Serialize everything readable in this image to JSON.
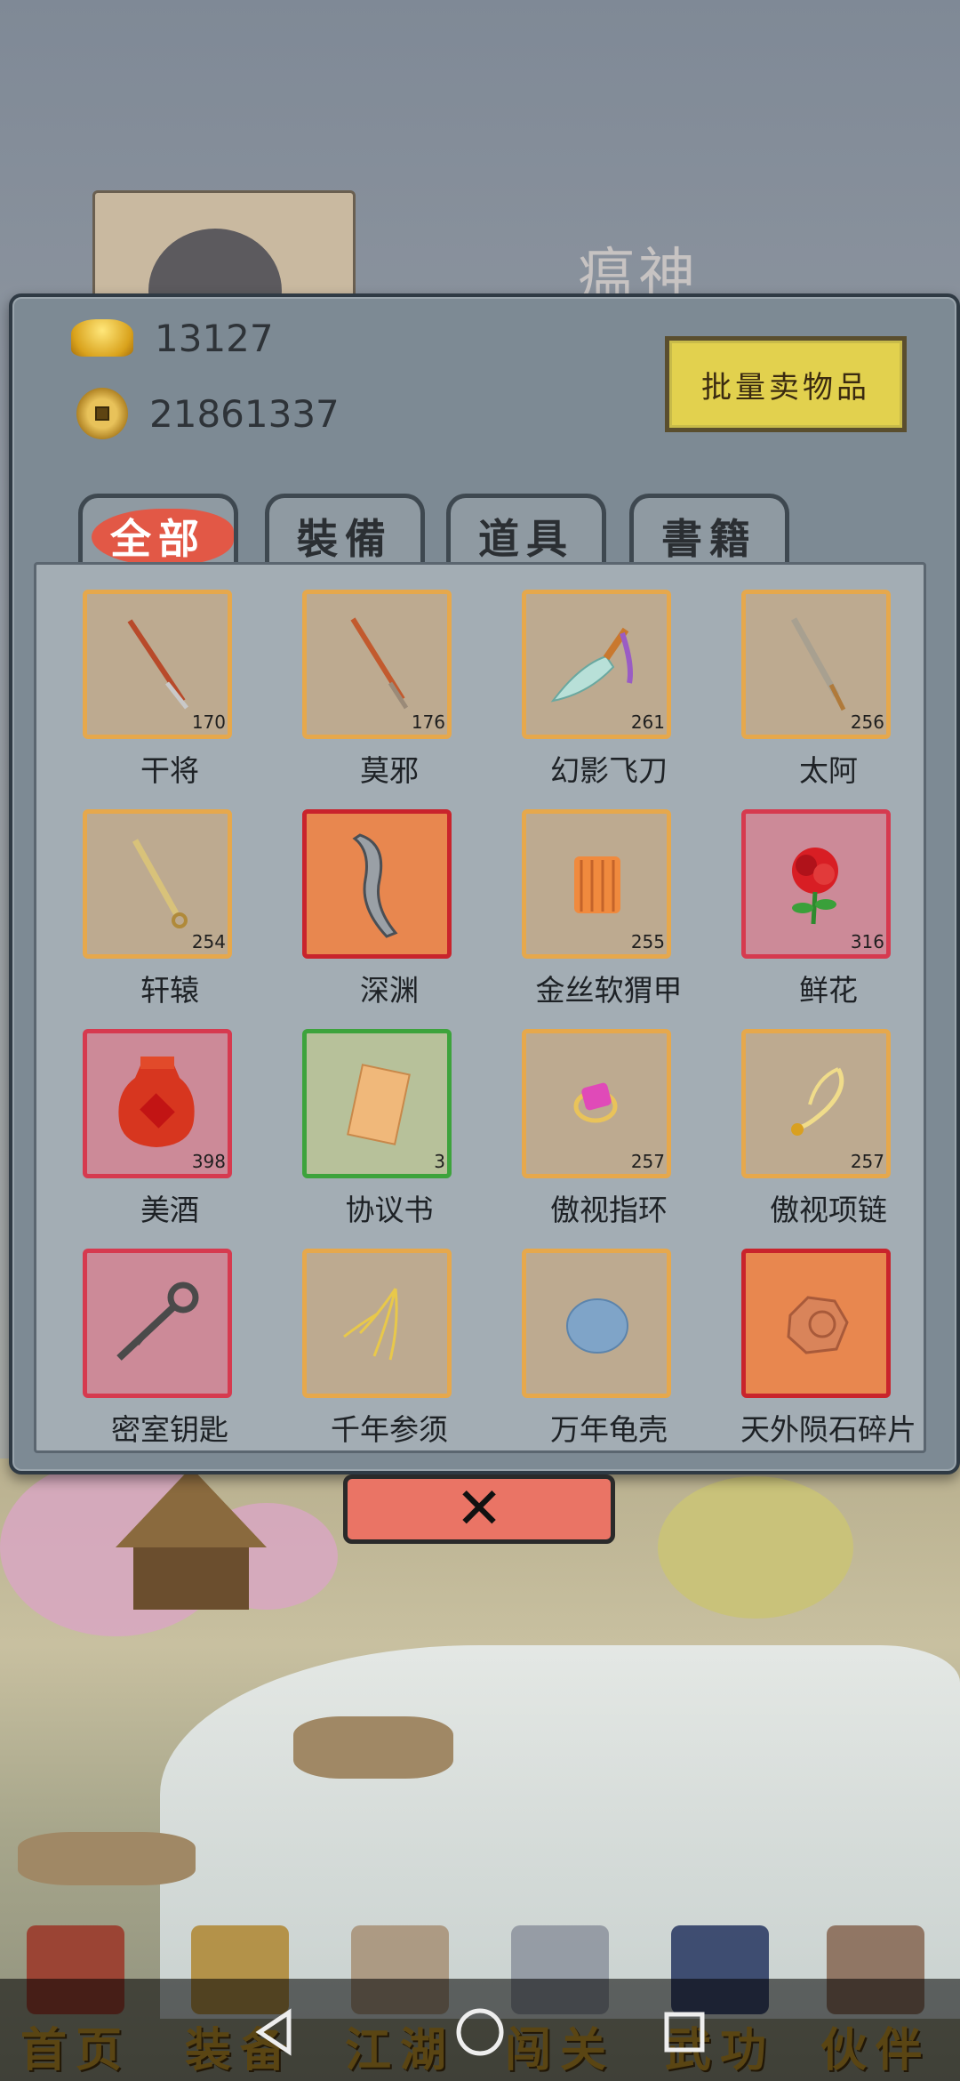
{
  "hero": {
    "name": "瘟神"
  },
  "currency": {
    "gold": "13127",
    "coins": "21861337"
  },
  "sell_button_label": "批量卖物品",
  "tabs": [
    {
      "label": "全部",
      "active": true
    },
    {
      "label": "裝備",
      "active": false
    },
    {
      "label": "道具",
      "active": false
    },
    {
      "label": "書籍",
      "active": false
    }
  ],
  "items": [
    {
      "name": "干将",
      "count": "170",
      "frame": "gold",
      "icon": "sword-icon"
    },
    {
      "name": "莫邪",
      "count": "176",
      "frame": "gold",
      "icon": "sword-icon"
    },
    {
      "name": "幻影飞刀",
      "count": "261",
      "frame": "gold",
      "icon": "flying-knife-icon"
    },
    {
      "name": "太阿",
      "count": "256",
      "frame": "gold",
      "icon": "sword-icon"
    },
    {
      "name": "轩辕",
      "count": "254",
      "frame": "gold",
      "icon": "sword-icon"
    },
    {
      "name": "深渊",
      "count": "",
      "frame": "orange-red",
      "icon": "blade-icon"
    },
    {
      "name": "金丝软猬甲",
      "count": "255",
      "frame": "gold",
      "icon": "armor-icon"
    },
    {
      "name": "鲜花",
      "count": "316",
      "frame": "red",
      "icon": "rose-icon"
    },
    {
      "name": "美酒",
      "count": "398",
      "frame": "red",
      "icon": "wine-jar-icon"
    },
    {
      "name": "协议书",
      "count": "3",
      "frame": "green",
      "icon": "scroll-icon"
    },
    {
      "name": "傲视指环",
      "count": "257",
      "frame": "gold",
      "icon": "ring-icon"
    },
    {
      "name": "傲视项链",
      "count": "257",
      "frame": "gold",
      "icon": "necklace-icon"
    },
    {
      "name": "密室钥匙",
      "count": "",
      "frame": "red",
      "icon": "key-icon"
    },
    {
      "name": "千年参须",
      "count": "",
      "frame": "gold",
      "icon": "ginseng-icon"
    },
    {
      "name": "万年龟壳",
      "count": "",
      "frame": "gold",
      "icon": "turtle-shell-icon"
    },
    {
      "name": "天外陨石碎片",
      "count": "",
      "frame": "orange-red",
      "icon": "meteorite-icon"
    }
  ],
  "close_label": "✕",
  "bottom_nav": [
    {
      "label": "首页",
      "icon": "temple-icon"
    },
    {
      "label": "装备",
      "icon": "armor-icon"
    },
    {
      "label": "江湖",
      "icon": "scroll-icon"
    },
    {
      "label": "闯关",
      "icon": "swords-icon"
    },
    {
      "label": "武功",
      "icon": "book-icon"
    },
    {
      "label": "伙伴",
      "icon": "people-icon"
    }
  ],
  "colors": {
    "panel": "#7d8a94",
    "frame_gold": "#e6a84c",
    "frame_red": "#d63a4f",
    "frame_green": "#3da33c",
    "active_tab": "#e25846",
    "sell_button": "#e2d14e",
    "close_button": "#ea7465"
  }
}
